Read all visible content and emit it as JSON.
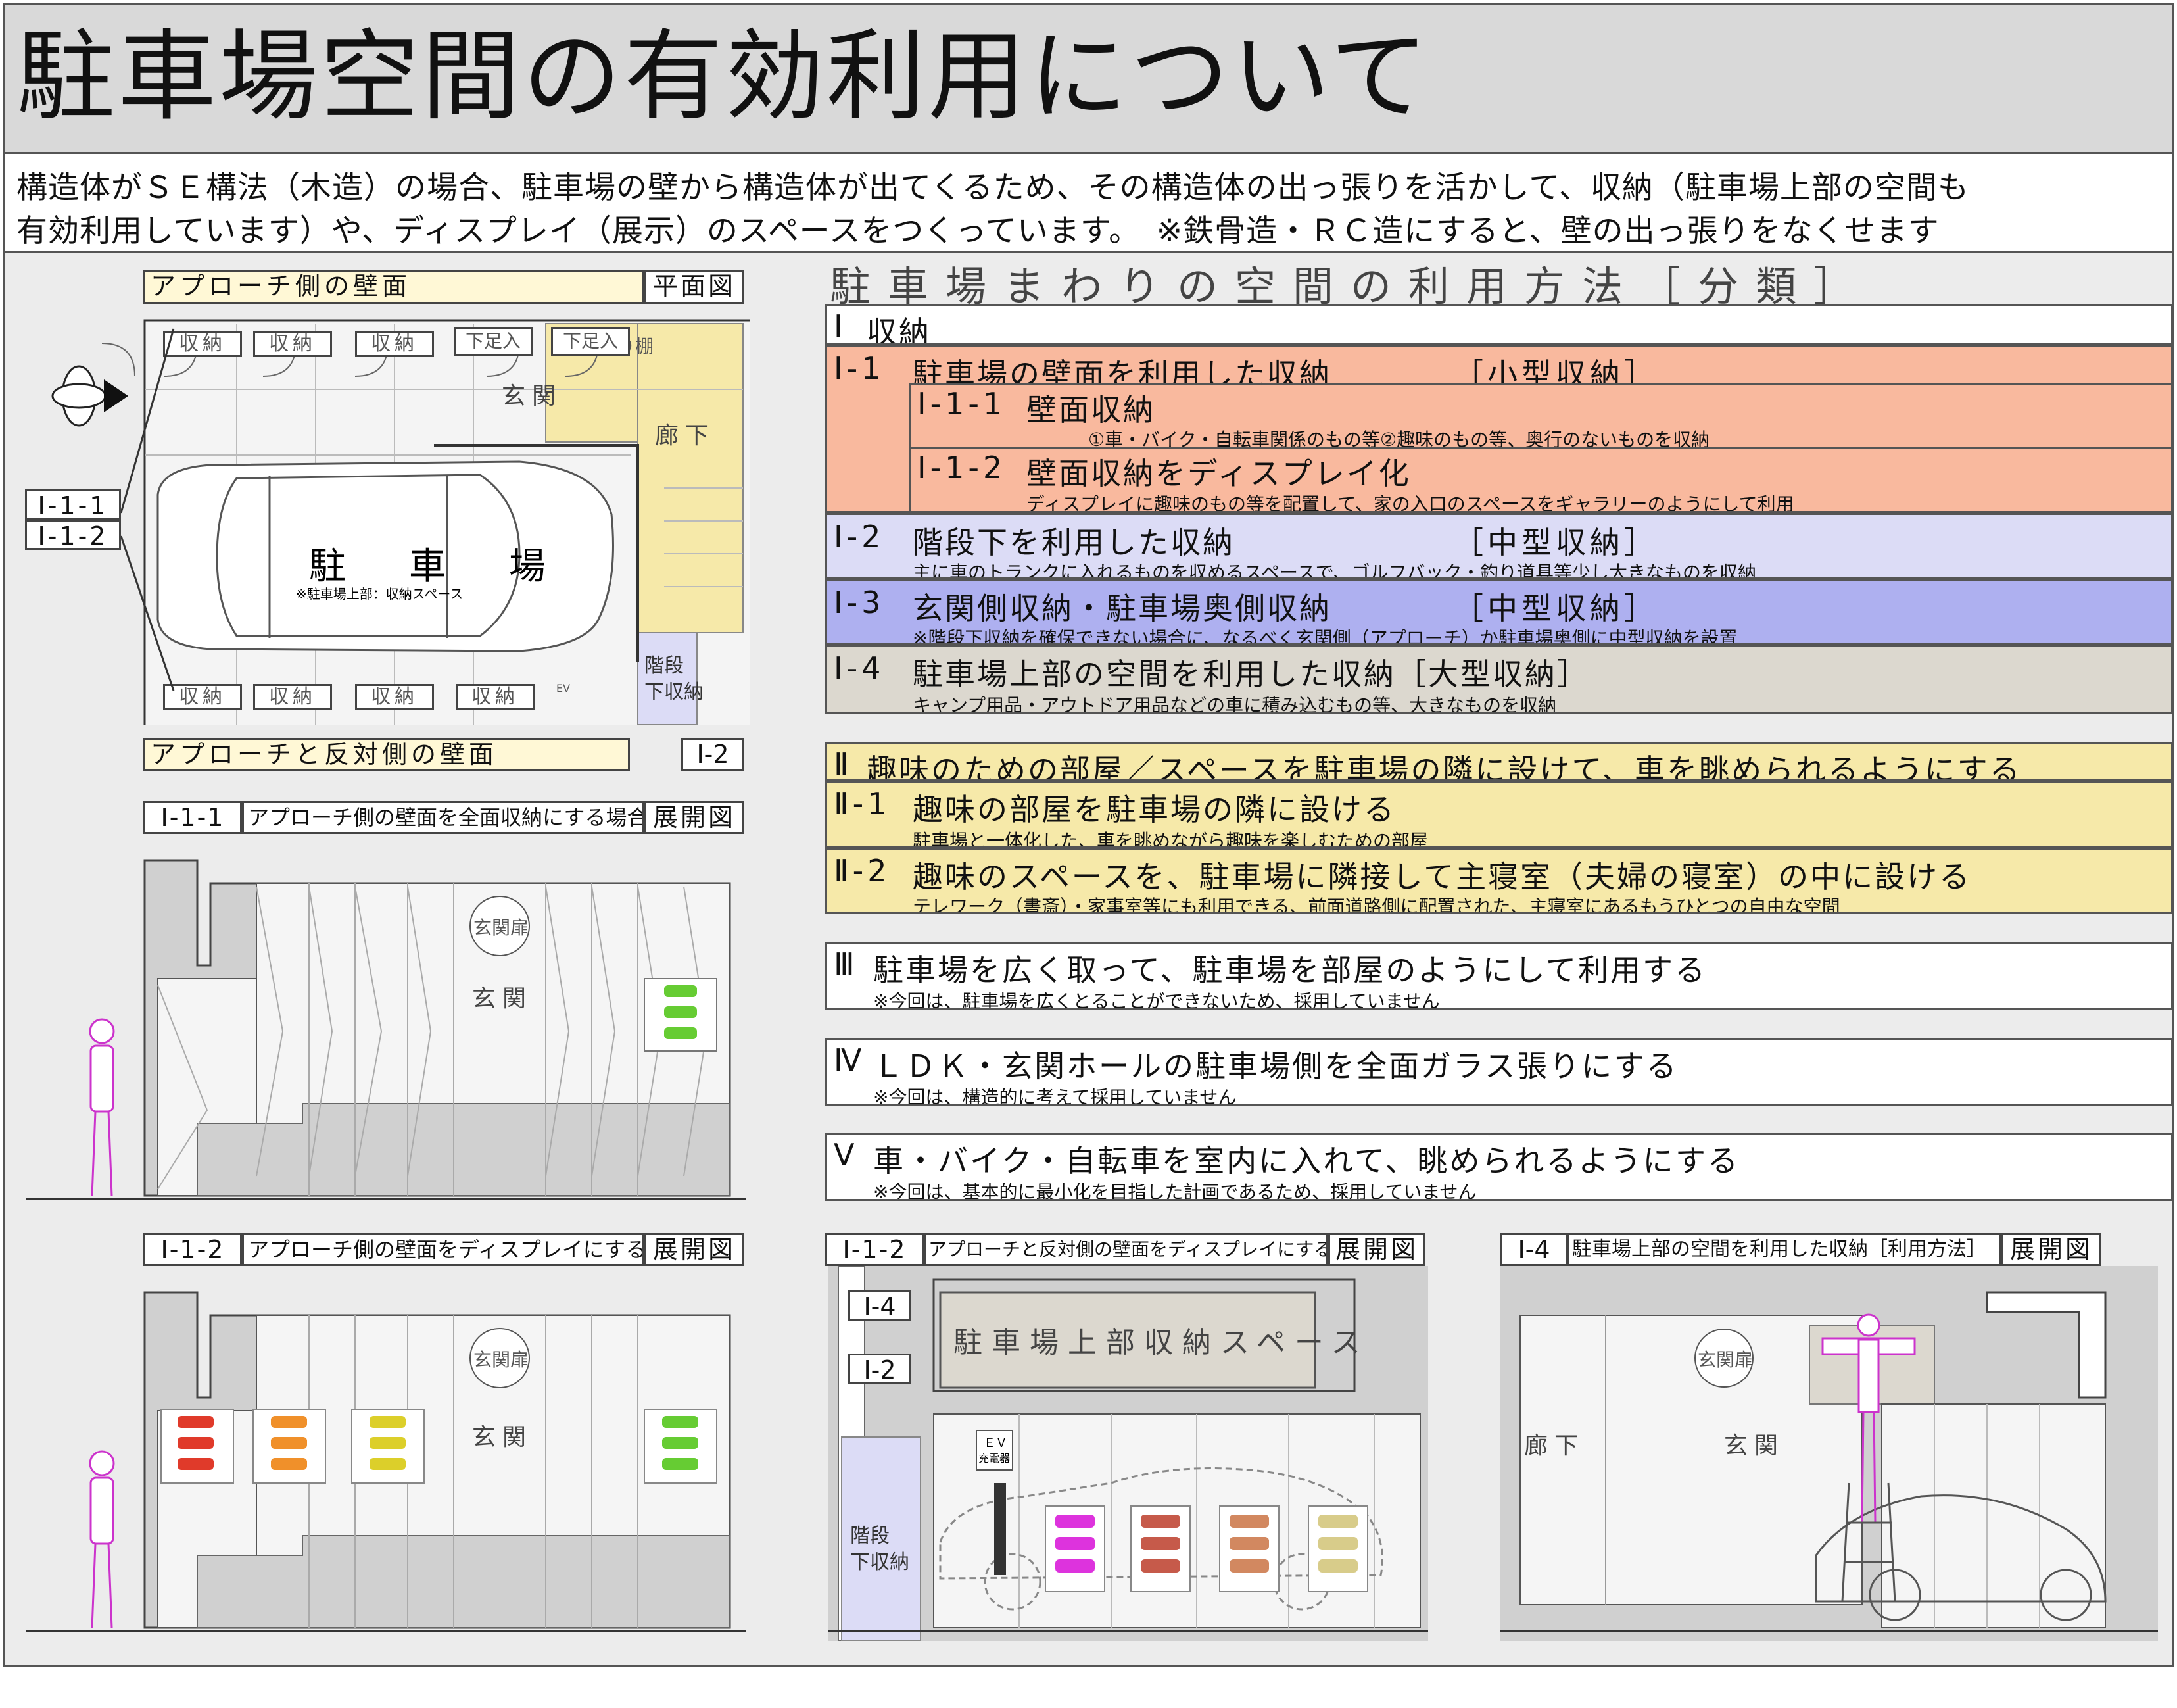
{
  "title": "駐車場空間の有効利用について",
  "intro": {
    "line1": "構造体がＳＥ構法（木造）の場合、駐車場の壁から構造体が出てくるため、その構造体の出っ張りを活かして、収納（駐車場上部の空間も",
    "line2": "有効利用しています）や、ディスプレイ（展示）のスペースをつくっています。　※鉄骨造・ＲＣ造にすると、壁の出っ張りをなくせます"
  },
  "classification": {
    "header": "駐車場まわりの空間の利用方法［分類］",
    "s1": {
      "num": "Ⅰ",
      "label": "収納",
      "i11_parent": {
        "num": "Ⅰ-1",
        "label": "駐車場の壁面を利用した収納",
        "tag": "［小型収納］"
      },
      "i111": {
        "num": "Ⅰ-1-1",
        "label": "壁面収納",
        "note": "①車・バイク・自転車関係のもの等②趣味のもの等、奥行のないものを収納"
      },
      "i112": {
        "num": "Ⅰ-1-2",
        "label": "壁面収納をディスプレイ化",
        "note": "ディスプレイに趣味のもの等を配置して、家の入口のスペースをギャラリーのようにして利用"
      },
      "i2": {
        "num": "Ⅰ-2",
        "label": "階段下を利用した収納",
        "tag": "［中型収納］",
        "note": "主に車のトランクに入れるものを収めるスペースで、ゴルフバック・釣り道具等少し大きなものを収納"
      },
      "i3": {
        "num": "Ⅰ-3",
        "label": "玄関側収納・駐車場奥側収納",
        "tag": "［中型収納］",
        "note": "※階段下収納を確保できない場合に、なるべく玄関側（アプローチ）か駐車場奥側に中型収納を設置"
      },
      "i4": {
        "num": "Ⅰ-4",
        "label": "駐車場上部の空間を利用した収納［大型収納］",
        "note": "キャンプ用品・アウトドア用品などの車に積み込むもの等、大きなものを収納"
      }
    },
    "s2": {
      "num": "Ⅱ",
      "label": "趣味のための部屋／スペースを駐車場の隣に設けて、車を眺められるようにする",
      "ii1": {
        "num": "Ⅱ-1",
        "label": "趣味の部屋を駐車場の隣に設ける",
        "note": "駐車場と一体化した、車を眺めながら趣味を楽しむための部屋"
      },
      "ii2": {
        "num": "Ⅱ-2",
        "label": "趣味のスペースを、駐車場に隣接して主寝室（夫婦の寝室）の中に設ける",
        "note": "テレワーク（書斎）・家事室等にも利用できる、前面道路側に配置された、主寝室にあるもうひとつの自由な空間"
      }
    },
    "s3": {
      "num": "Ⅲ",
      "label": "駐車場を広く取って、駐車場を部屋のようにして利用する",
      "note": "※今回は、駐車場を広くとることができないため、採用していません"
    },
    "s4": {
      "num": "Ⅳ",
      "label": "ＬＤＫ・玄関ホールの駐車場側を全面ガラス張りにする",
      "note": "※今回は、構造的に考えて採用していません"
    },
    "s5": {
      "num": "Ⅴ",
      "label": "車・バイク・自転車を室内に入れて、眺められるようにする",
      "note": "※今回は、基本的に最小化を目指した計画であるため、採用していません"
    }
  },
  "plan": {
    "top_label": "アプローチ側の壁面",
    "plan_label": "平面図",
    "bottom_label": "アプローチと反対側の壁面",
    "storage": "収納",
    "shoe": "下足入",
    "shelf": "飾り棚",
    "genkan": "玄関",
    "corridor": "廊下",
    "parking": "駐　車　場",
    "parking_note": "※駐車場上部：収納スペース",
    "stairs1": "階段",
    "stairs2": "下収納",
    "ev": "EV",
    "tag_i111": "Ⅰ-1-1",
    "tag_i112": "Ⅰ-1-2",
    "tag_i2": "Ⅰ-2"
  },
  "elev1": {
    "code": "Ⅰ-1-1",
    "title": "アプローチ側の壁面を全面収納にする場合",
    "kind": "展開図",
    "door": "玄関扉",
    "genkan": "玄関"
  },
  "elev2": {
    "code": "Ⅰ-1-2",
    "title": "アプローチ側の壁面をディスプレイにする場合",
    "kind": "展開図",
    "door": "玄関扉",
    "genkan": "玄関"
  },
  "elev3": {
    "code": "Ⅰ-1-2",
    "title": "アプローチと反対側の壁面をディスプレイにする場合",
    "kind": "展開図",
    "tag_i4": "Ⅰ-4",
    "tag_i2": "Ⅰ-2",
    "upper": "駐車場上部収納スペース",
    "stairs1": "階段",
    "stairs2": "下収納",
    "ev1": "ＥＶ",
    "ev2": "充電器"
  },
  "elev4": {
    "code": "Ⅰ-4",
    "title": "駐車場上部の空間を利用した収納［利用方法］",
    "kind": "展開図",
    "corridor": "廊下",
    "genkan": "玄関",
    "door": "玄関扉"
  },
  "colors": {
    "red": "#f9b99e",
    "lavender": "#dcdcf6",
    "blue": "#aeb0f0",
    "tan": "#dcd8cf",
    "yellow": "#f6e9a9",
    "magenta": "#cc33cc"
  }
}
